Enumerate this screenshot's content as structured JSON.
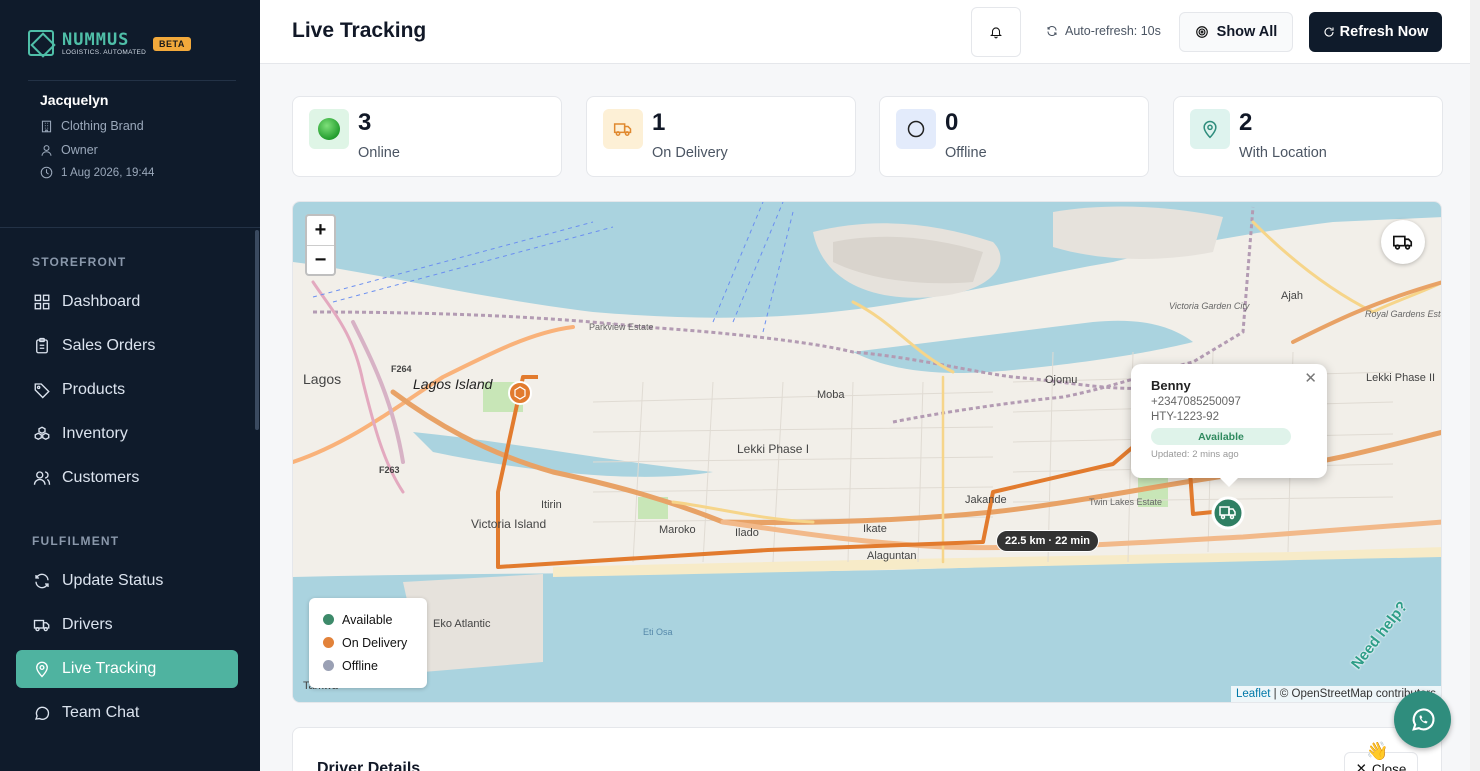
{
  "brand": {
    "name": "NUMMUS",
    "tagline": "LOGISTICS. AUTOMATED",
    "badge": "BETA"
  },
  "user": {
    "name": "Jacquelyn",
    "company": "Clothing Brand",
    "role": "Owner",
    "datetime": "1 Aug 2026, 19:44"
  },
  "nav": {
    "sections": [
      {
        "title": "STOREFRONT",
        "items": [
          {
            "label": "Dashboard",
            "icon": "grid-icon"
          },
          {
            "label": "Sales Orders",
            "icon": "clipboard-icon"
          },
          {
            "label": "Products",
            "icon": "tag-icon"
          },
          {
            "label": "Inventory",
            "icon": "boxes-icon"
          },
          {
            "label": "Customers",
            "icon": "users-icon"
          }
        ]
      },
      {
        "title": "FULFILMENT",
        "items": [
          {
            "label": "Update Status",
            "icon": "refresh-icon"
          },
          {
            "label": "Drivers",
            "icon": "truck-icon"
          },
          {
            "label": "Live Tracking",
            "icon": "pin-icon",
            "active": true
          },
          {
            "label": "Team Chat",
            "icon": "chat-icon"
          }
        ]
      }
    ]
  },
  "header": {
    "title": "Live Tracking",
    "auto_refresh": "Auto-refresh: 10s",
    "show_all": "Show All",
    "refresh_now": "Refresh Now"
  },
  "stats": [
    {
      "value": "3",
      "label": "Online",
      "color": "#dff5e6"
    },
    {
      "value": "1",
      "label": "On Delivery",
      "color": "#fdf0d6"
    },
    {
      "value": "0",
      "label": "Offline",
      "color": "#e3ebfb"
    },
    {
      "value": "2",
      "label": "With Location",
      "color": "#def3ee"
    }
  ],
  "map": {
    "places": [
      "Lagos",
      "Lagos Island",
      "Parkview Estate",
      "Moba",
      "Ojomu",
      "Lekki Phase I",
      "Victoria Island",
      "Itirin",
      "Maroko",
      "Ilado",
      "Ikate",
      "Jakande",
      "Alaguntan",
      "Eko Atlantic",
      "Ajah",
      "Victoria Garden City",
      "Royal Gardens Estate, Ajah, Lekki, Lagos.",
      "Lekki Phase II",
      "Twin Lakes Estate",
      "Tarkwa",
      "Eti Osa",
      "F264",
      "F263"
    ],
    "legend": [
      {
        "label": "Available",
        "color": "#3d8a6a"
      },
      {
        "label": "On Delivery",
        "color": "#e2823a"
      },
      {
        "label": "Offline",
        "color": "#9aa0b4"
      }
    ],
    "popup": {
      "name": "Benny",
      "phone": "+2347085250097",
      "plate": "HTY-1223-92",
      "status": "Available",
      "updated": "Updated: 2 mins ago"
    },
    "route_label": "22.5 km · 22 min",
    "attribution_link": "Leaflet",
    "attribution_text": "| © OpenStreetMap contributors",
    "zoom_in": "+",
    "zoom_out": "−"
  },
  "details": {
    "title": "Driver Details",
    "close": "Close"
  },
  "help": {
    "label": "Need help?"
  }
}
